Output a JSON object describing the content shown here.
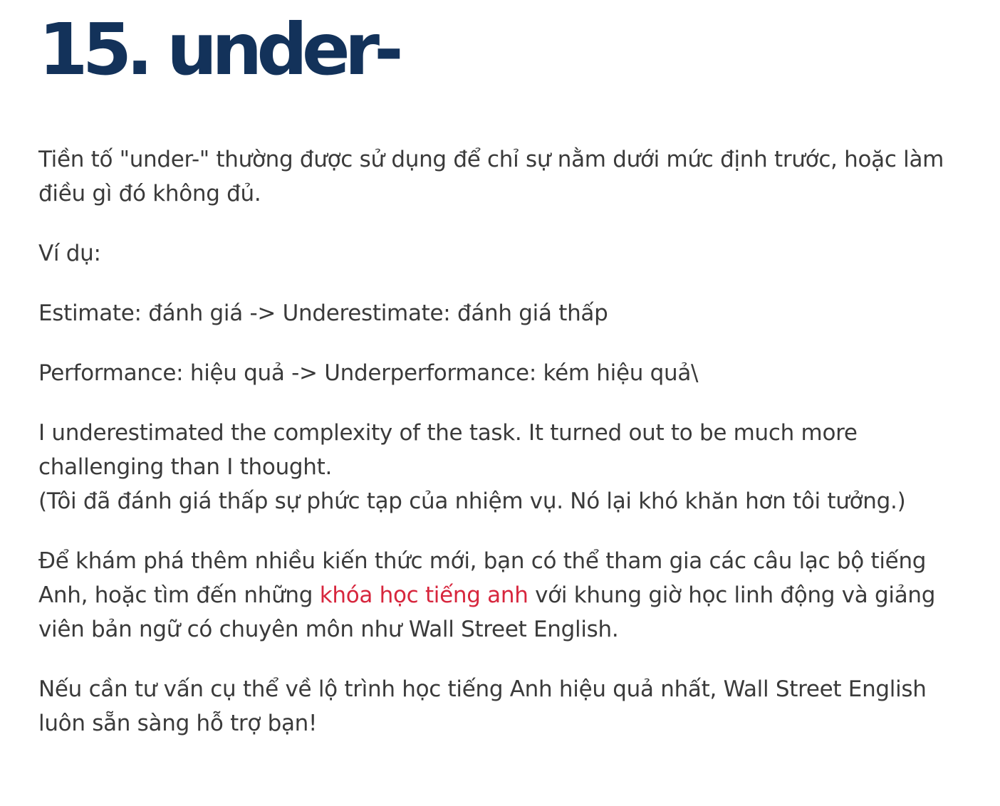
{
  "heading": "15. under-",
  "paragraphs": {
    "intro": "Tiền tố \"under-\" thường được sử dụng để chỉ sự nằm dưới mức định trước, hoặc làm điều gì đó không đủ.",
    "example_label": "Ví dụ:",
    "example_1": "Estimate: đánh giá -> Underestimate: đánh giá thấp",
    "example_2": "Performance: hiệu quả -> Underperformance: kém hiệu quả\\",
    "sentence_en": "I underestimated the complexity of the task. It turned out to be much more challenging than I thought.",
    "sentence_vi": "(Tôi đã đánh giá thấp sự phức tạp của nhiệm vụ. Nó lại khó khăn hơn tôi tưởng.)",
    "promo_before": "Để khám phá thêm nhiều kiến thức mới, bạn có thể tham gia các câu lạc bộ tiếng Anh, hoặc tìm đến những ",
    "promo_link": "khóa học tiếng anh",
    "promo_after": " với khung giờ học linh động và giảng viên bản ngữ có chuyên môn như Wall Street English.",
    "closing": "Nếu cần tư vấn cụ thể về lộ trình học tiếng Anh hiệu quả nhất, Wall Street English luôn sẵn sàng hỗ trợ bạn!"
  },
  "colors": {
    "heading": "#13325a",
    "body_text": "#3a3a3a",
    "link": "#d7263d",
    "background": "#ffffff"
  }
}
